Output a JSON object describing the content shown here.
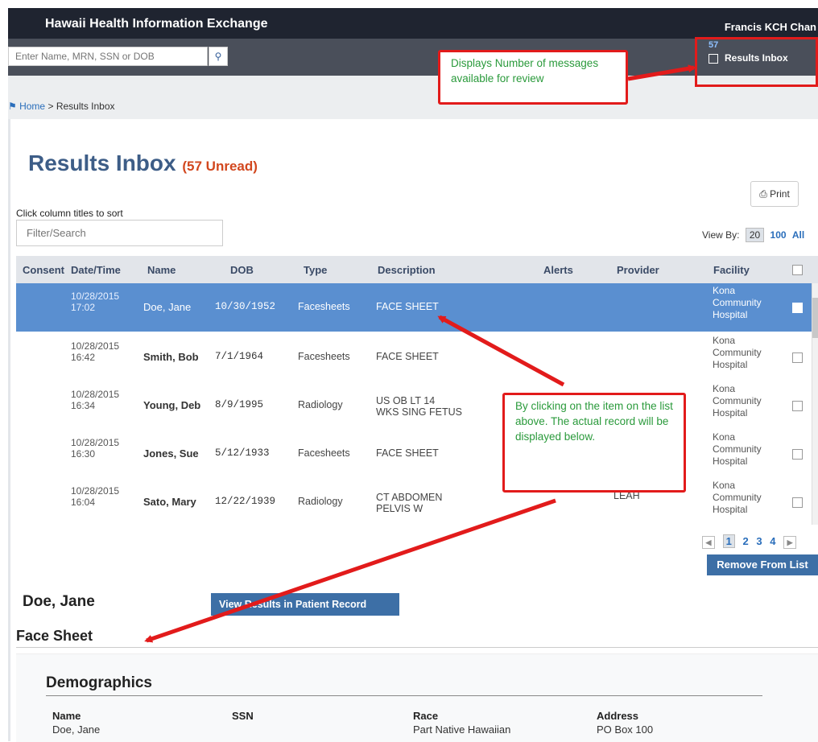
{
  "header": {
    "app_title": "Hawaii Health Information Exchange",
    "user_name": "Francis KCH Chan",
    "search_placeholder": "Enter Name, MRN, SSN or DOB",
    "inbox_count": "57",
    "inbox_label": "Results Inbox"
  },
  "breadcrumb": {
    "home": "Home",
    "separator": ">",
    "current": "Results Inbox"
  },
  "page": {
    "title": "Results Inbox",
    "unread": "(57 Unread)",
    "print_label": "Print",
    "sort_hint": "Click column titles to sort",
    "filter_placeholder": "Filter/Search",
    "view_by_label": "View By:",
    "view_by_options": [
      "20",
      "100",
      "All"
    ]
  },
  "table": {
    "columns": [
      "Consent",
      "Date/Time",
      "Name",
      "DOB",
      "Type",
      "Description",
      "Alerts",
      "Provider",
      "Facility"
    ],
    "rows": [
      {
        "date": "10/28/2015",
        "time": "17:02",
        "name": "Doe, Jane",
        "dob": "10/30/1952",
        "type": "Facesheets",
        "desc1": "FACE SHEET",
        "desc2": "",
        "provider1": "",
        "provider2": "",
        "facility1": "Kona",
        "facility2": "Community",
        "facility3": "Hospital"
      },
      {
        "date": "10/28/2015",
        "time": "16:42",
        "name": "Smith, Bob",
        "dob": "7/1/1964",
        "type": "Facesheets",
        "desc1": "FACE SHEET",
        "desc2": "",
        "provider1": "",
        "provider2": "",
        "facility1": "Kona",
        "facility2": "Community",
        "facility3": "Hospital"
      },
      {
        "date": "10/28/2015",
        "time": "16:34",
        "name": "Young, Deb",
        "dob": "8/9/1995",
        "type": "Radiology",
        "desc1": "US OB LT 14",
        "desc2": "WKS SING FETUS",
        "provider1": "",
        "provider2": "",
        "facility1": "Kona",
        "facility2": "Community",
        "facility3": "Hospital"
      },
      {
        "date": "10/28/2015",
        "time": "16:30",
        "name": "Jones, Sue",
        "dob": "5/12/1933",
        "type": "Facesheets",
        "desc1": "FACE SHEET",
        "desc2": "",
        "provider1": "",
        "provider2": "",
        "facility1": "Kona",
        "facility2": "Community",
        "facility3": "Hospital"
      },
      {
        "date": "10/28/2015",
        "time": "16:04",
        "name": "Sato, Mary",
        "dob": "12/22/1939",
        "type": "Radiology",
        "desc1": "CT ABDOMEN",
        "desc2": "PELVIS W",
        "provider1": "",
        "provider2": "LEAH",
        "facility1": "Kona",
        "facility2": "Community",
        "facility3": "Hospital"
      }
    ]
  },
  "pager": {
    "pages": [
      "1",
      "2",
      "3",
      "4"
    ],
    "current": "1"
  },
  "actions": {
    "remove_label": "Remove From List",
    "view_results_label": "View Results in Patient Record"
  },
  "record": {
    "patient_name": "Doe, Jane",
    "section_title": "Face Sheet",
    "demographics_title": "Demographics",
    "fields": [
      {
        "label": "Name",
        "value": "Doe, Jane"
      },
      {
        "label": "SSN",
        "value": ""
      },
      {
        "label": "Race",
        "value": "Part Native Hawaiian"
      },
      {
        "label": "Address",
        "value": "PO Box  100"
      }
    ]
  },
  "callouts": {
    "inbox_note": "Displays Number of messages available for review",
    "list_note": "By clicking on the item on the list above.  The actual record will be displayed below."
  },
  "colors": {
    "accent_blue": "#3d6fa6",
    "selected_row": "#5a8fd0",
    "annotation_red": "#e21b1b",
    "annotation_text": "#2a9a3b",
    "unread": "#d2471e"
  }
}
